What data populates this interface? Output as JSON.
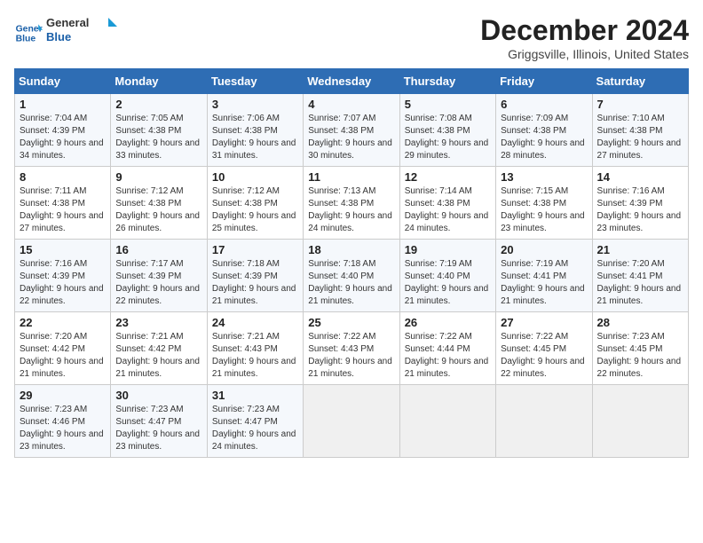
{
  "logo": {
    "line1": "General",
    "line2": "Blue"
  },
  "title": "December 2024",
  "subtitle": "Griggsville, Illinois, United States",
  "days_of_week": [
    "Sunday",
    "Monday",
    "Tuesday",
    "Wednesday",
    "Thursday",
    "Friday",
    "Saturday"
  ],
  "weeks": [
    [
      {
        "day": "1",
        "sunrise": "7:04 AM",
        "sunset": "4:39 PM",
        "daylight": "9 hours and 34 minutes."
      },
      {
        "day": "2",
        "sunrise": "7:05 AM",
        "sunset": "4:38 PM",
        "daylight": "9 hours and 33 minutes."
      },
      {
        "day": "3",
        "sunrise": "7:06 AM",
        "sunset": "4:38 PM",
        "daylight": "9 hours and 31 minutes."
      },
      {
        "day": "4",
        "sunrise": "7:07 AM",
        "sunset": "4:38 PM",
        "daylight": "9 hours and 30 minutes."
      },
      {
        "day": "5",
        "sunrise": "7:08 AM",
        "sunset": "4:38 PM",
        "daylight": "9 hours and 29 minutes."
      },
      {
        "day": "6",
        "sunrise": "7:09 AM",
        "sunset": "4:38 PM",
        "daylight": "9 hours and 28 minutes."
      },
      {
        "day": "7",
        "sunrise": "7:10 AM",
        "sunset": "4:38 PM",
        "daylight": "9 hours and 27 minutes."
      }
    ],
    [
      {
        "day": "8",
        "sunrise": "7:11 AM",
        "sunset": "4:38 PM",
        "daylight": "9 hours and 27 minutes."
      },
      {
        "day": "9",
        "sunrise": "7:12 AM",
        "sunset": "4:38 PM",
        "daylight": "9 hours and 26 minutes."
      },
      {
        "day": "10",
        "sunrise": "7:12 AM",
        "sunset": "4:38 PM",
        "daylight": "9 hours and 25 minutes."
      },
      {
        "day": "11",
        "sunrise": "7:13 AM",
        "sunset": "4:38 PM",
        "daylight": "9 hours and 24 minutes."
      },
      {
        "day": "12",
        "sunrise": "7:14 AM",
        "sunset": "4:38 PM",
        "daylight": "9 hours and 24 minutes."
      },
      {
        "day": "13",
        "sunrise": "7:15 AM",
        "sunset": "4:38 PM",
        "daylight": "9 hours and 23 minutes."
      },
      {
        "day": "14",
        "sunrise": "7:16 AM",
        "sunset": "4:39 PM",
        "daylight": "9 hours and 23 minutes."
      }
    ],
    [
      {
        "day": "15",
        "sunrise": "7:16 AM",
        "sunset": "4:39 PM",
        "daylight": "9 hours and 22 minutes."
      },
      {
        "day": "16",
        "sunrise": "7:17 AM",
        "sunset": "4:39 PM",
        "daylight": "9 hours and 22 minutes."
      },
      {
        "day": "17",
        "sunrise": "7:18 AM",
        "sunset": "4:39 PM",
        "daylight": "9 hours and 21 minutes."
      },
      {
        "day": "18",
        "sunrise": "7:18 AM",
        "sunset": "4:40 PM",
        "daylight": "9 hours and 21 minutes."
      },
      {
        "day": "19",
        "sunrise": "7:19 AM",
        "sunset": "4:40 PM",
        "daylight": "9 hours and 21 minutes."
      },
      {
        "day": "20",
        "sunrise": "7:19 AM",
        "sunset": "4:41 PM",
        "daylight": "9 hours and 21 minutes."
      },
      {
        "day": "21",
        "sunrise": "7:20 AM",
        "sunset": "4:41 PM",
        "daylight": "9 hours and 21 minutes."
      }
    ],
    [
      {
        "day": "22",
        "sunrise": "7:20 AM",
        "sunset": "4:42 PM",
        "daylight": "9 hours and 21 minutes."
      },
      {
        "day": "23",
        "sunrise": "7:21 AM",
        "sunset": "4:42 PM",
        "daylight": "9 hours and 21 minutes."
      },
      {
        "day": "24",
        "sunrise": "7:21 AM",
        "sunset": "4:43 PM",
        "daylight": "9 hours and 21 minutes."
      },
      {
        "day": "25",
        "sunrise": "7:22 AM",
        "sunset": "4:43 PM",
        "daylight": "9 hours and 21 minutes."
      },
      {
        "day": "26",
        "sunrise": "7:22 AM",
        "sunset": "4:44 PM",
        "daylight": "9 hours and 21 minutes."
      },
      {
        "day": "27",
        "sunrise": "7:22 AM",
        "sunset": "4:45 PM",
        "daylight": "9 hours and 22 minutes."
      },
      {
        "day": "28",
        "sunrise": "7:23 AM",
        "sunset": "4:45 PM",
        "daylight": "9 hours and 22 minutes."
      }
    ],
    [
      {
        "day": "29",
        "sunrise": "7:23 AM",
        "sunset": "4:46 PM",
        "daylight": "9 hours and 23 minutes."
      },
      {
        "day": "30",
        "sunrise": "7:23 AM",
        "sunset": "4:47 PM",
        "daylight": "9 hours and 23 minutes."
      },
      {
        "day": "31",
        "sunrise": "7:23 AM",
        "sunset": "4:47 PM",
        "daylight": "9 hours and 24 minutes."
      },
      null,
      null,
      null,
      null
    ]
  ]
}
